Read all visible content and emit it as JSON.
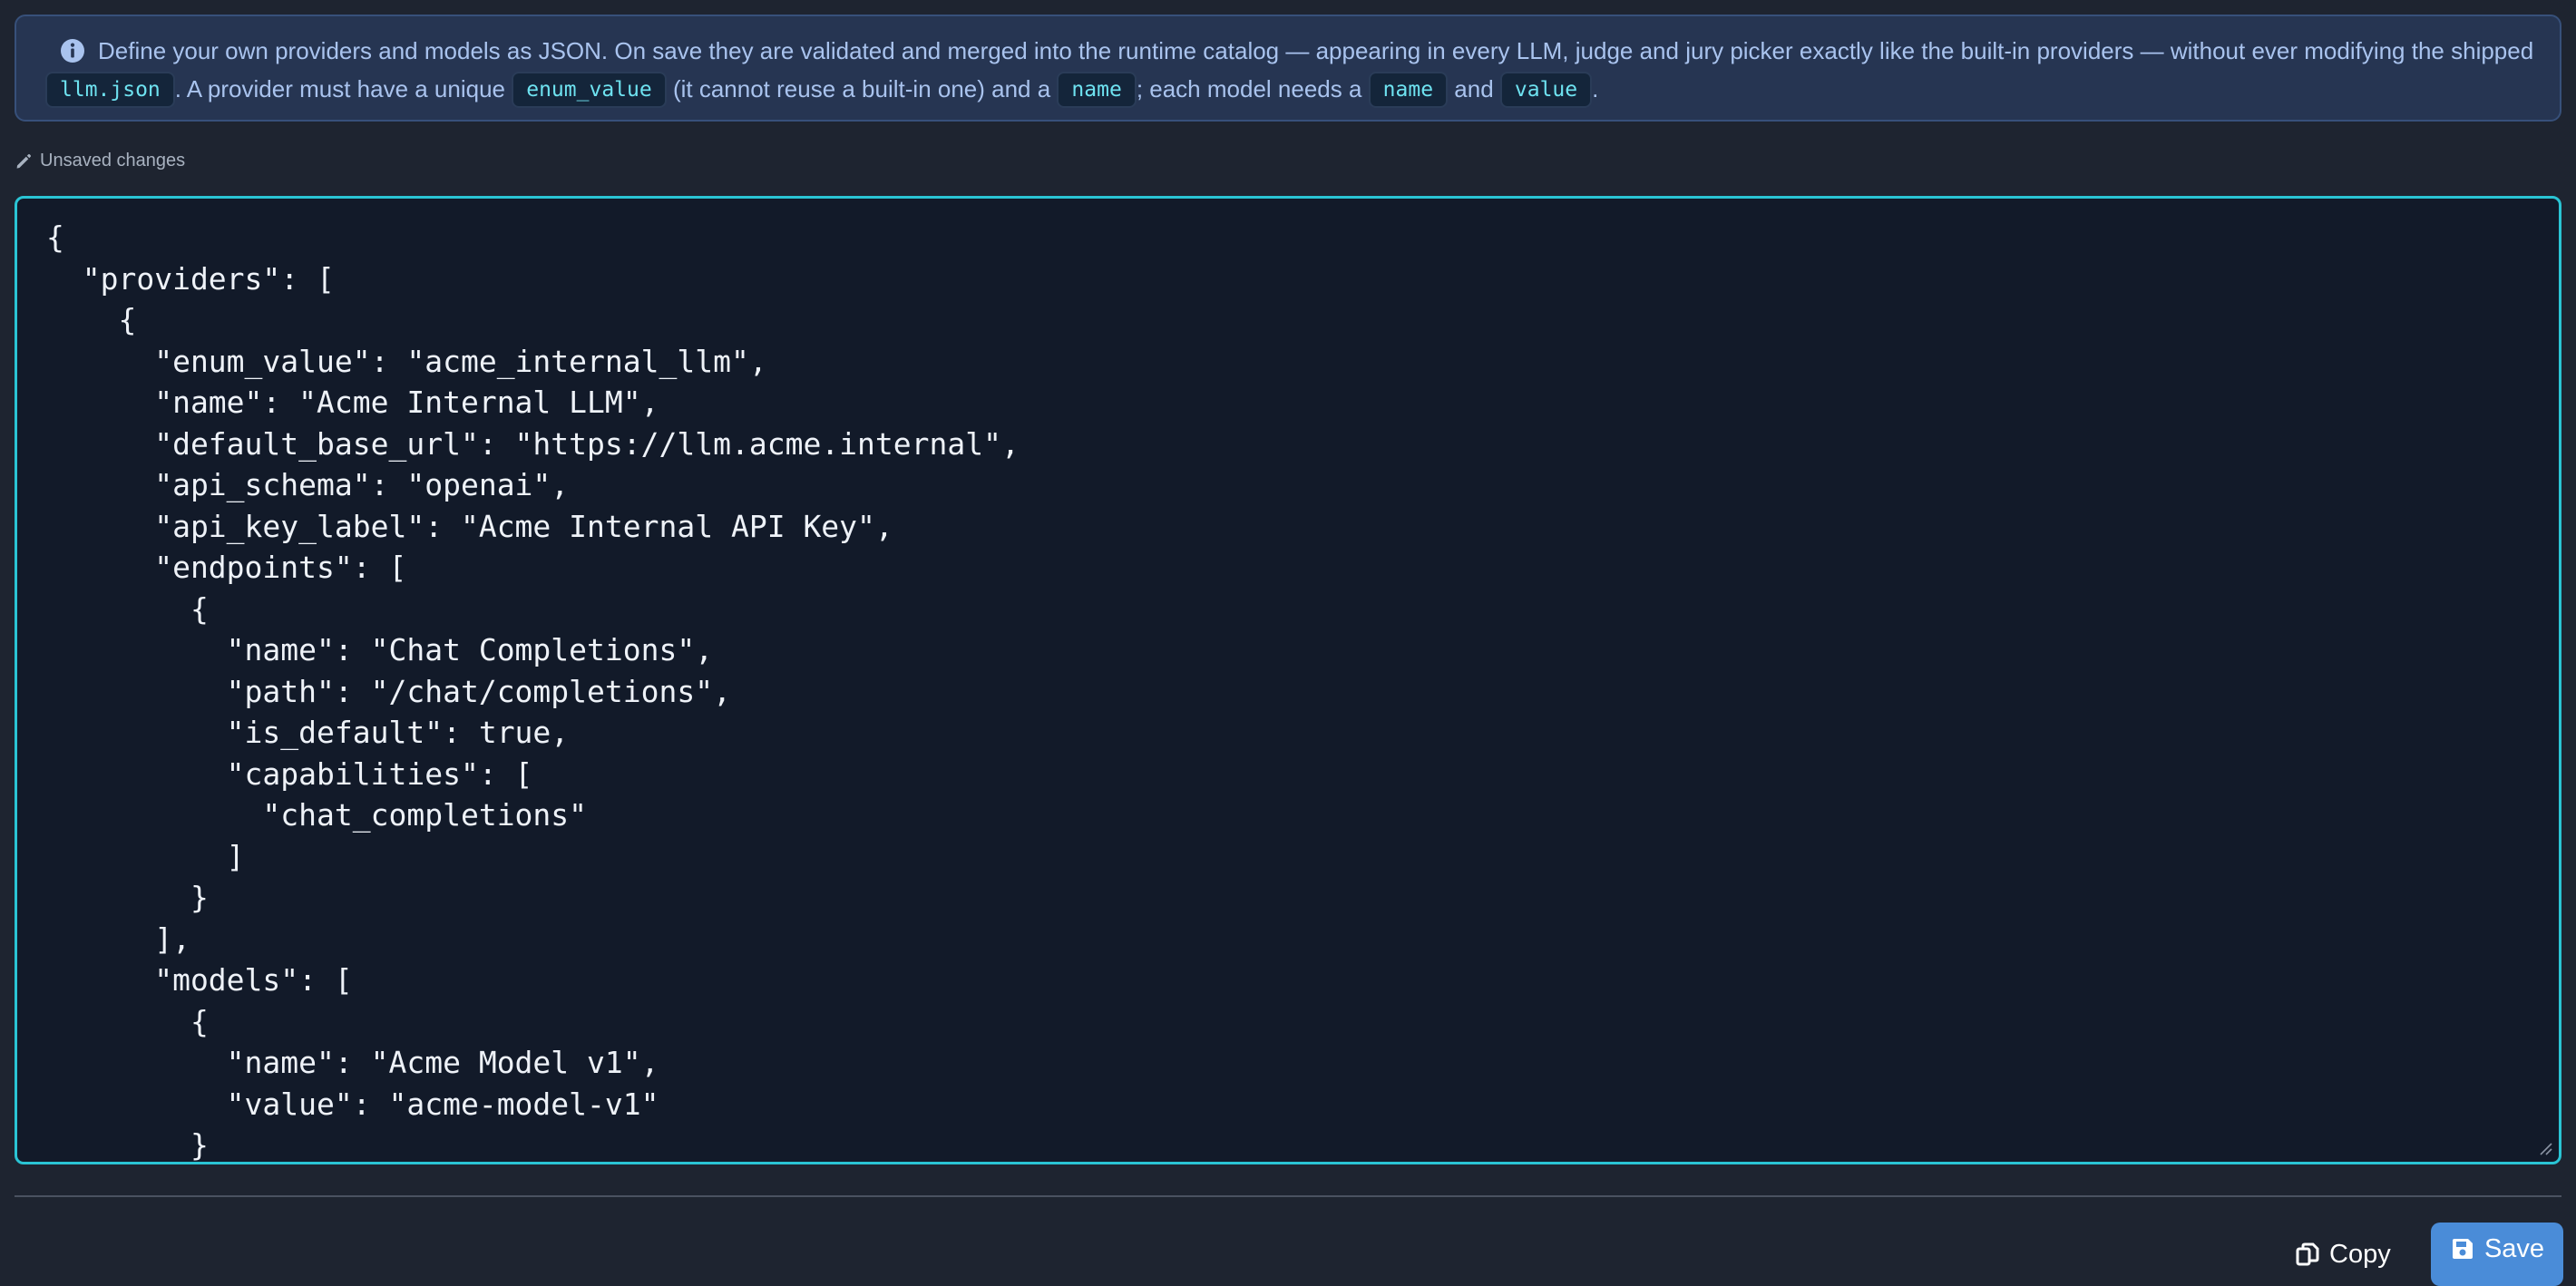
{
  "info": {
    "text_1": "Define your own providers and models as JSON. On save they are validated and merged into the runtime catalog — appearing in every LLM, judge and jury picker exactly like the built-in providers — without ever modifying the shipped ",
    "code_1": "llm.json",
    "text_2": ". A provider must have a unique ",
    "code_2": "enum_value",
    "text_3": " (it cannot reuse a built-in one) and a ",
    "code_3": "name",
    "text_4": "; each model needs a ",
    "code_4": "name",
    "text_5": " and ",
    "code_5": "value",
    "text_6": "."
  },
  "status": {
    "label": "Unsaved changes",
    "icon": "pencil-icon"
  },
  "editor": {
    "content": "{\n  \"providers\": [\n    {\n      \"enum_value\": \"acme_internal_llm\",\n      \"name\": \"Acme Internal LLM\",\n      \"default_base_url\": \"https://llm.acme.internal\",\n      \"api_schema\": \"openai\",\n      \"api_key_label\": \"Acme Internal API Key\",\n      \"endpoints\": [\n        {\n          \"name\": \"Chat Completions\",\n          \"path\": \"/chat/completions\",\n          \"is_default\": true,\n          \"capabilities\": [\n            \"chat_completions\"\n          ]\n        }\n      ],\n      \"models\": [\n        {\n          \"name\": \"Acme Model v1\",\n          \"value\": \"acme-model-v1\"\n        }\n      ]\n    }\n  ]\n}"
  },
  "actions": {
    "copy_label": "Copy",
    "save_label": "Save"
  },
  "colors": {
    "background": "#1e2430",
    "info_background": "#263552",
    "editor_border": "#2ac4d4",
    "code_text": "#6ee2f0",
    "save_button": "#4a8cd8"
  }
}
